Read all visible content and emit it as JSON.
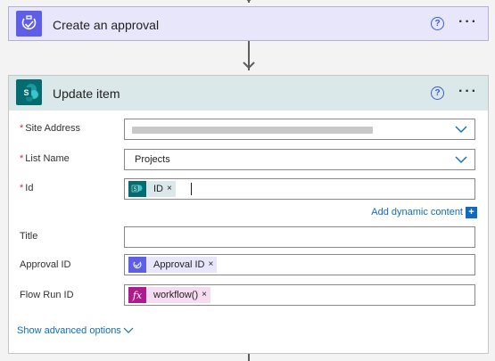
{
  "approval_card": {
    "title": "Create an approval",
    "help_symbol": "?",
    "more_symbol": "···",
    "icon": "approval-icon"
  },
  "update_card": {
    "title": "Update item",
    "help_symbol": "?",
    "more_symbol": "···",
    "icon": "sharepoint-icon",
    "fields": {
      "site_address": {
        "label": "Site Address",
        "required": "*",
        "value": ""
      },
      "list_name": {
        "label": "List Name",
        "required": "*",
        "value": "Projects"
      },
      "id": {
        "label": "Id",
        "required": "*",
        "token": {
          "label": "ID",
          "remove": "×",
          "icon": "sharepoint-icon"
        }
      },
      "title": {
        "label": "Title",
        "value": ""
      },
      "approval_id": {
        "label": "Approval ID",
        "token": {
          "label": "Approval ID",
          "remove": "×",
          "icon": "approval-icon"
        }
      },
      "flow_run_id": {
        "label": "Flow Run ID",
        "token": {
          "label": "workflow()",
          "remove": "×",
          "icon": "fx",
          "icon_text": "fx"
        }
      }
    },
    "add_dynamic_content": "Add dynamic content",
    "add_dynamic_plus": "+",
    "show_advanced": "Show advanced options"
  },
  "colors": {
    "approval_accent": "#5e5ee6",
    "sharepoint_accent": "#036c70",
    "expression_accent": "#ad1b8e",
    "link": "#0f6cbd",
    "required": "#c4314b"
  }
}
